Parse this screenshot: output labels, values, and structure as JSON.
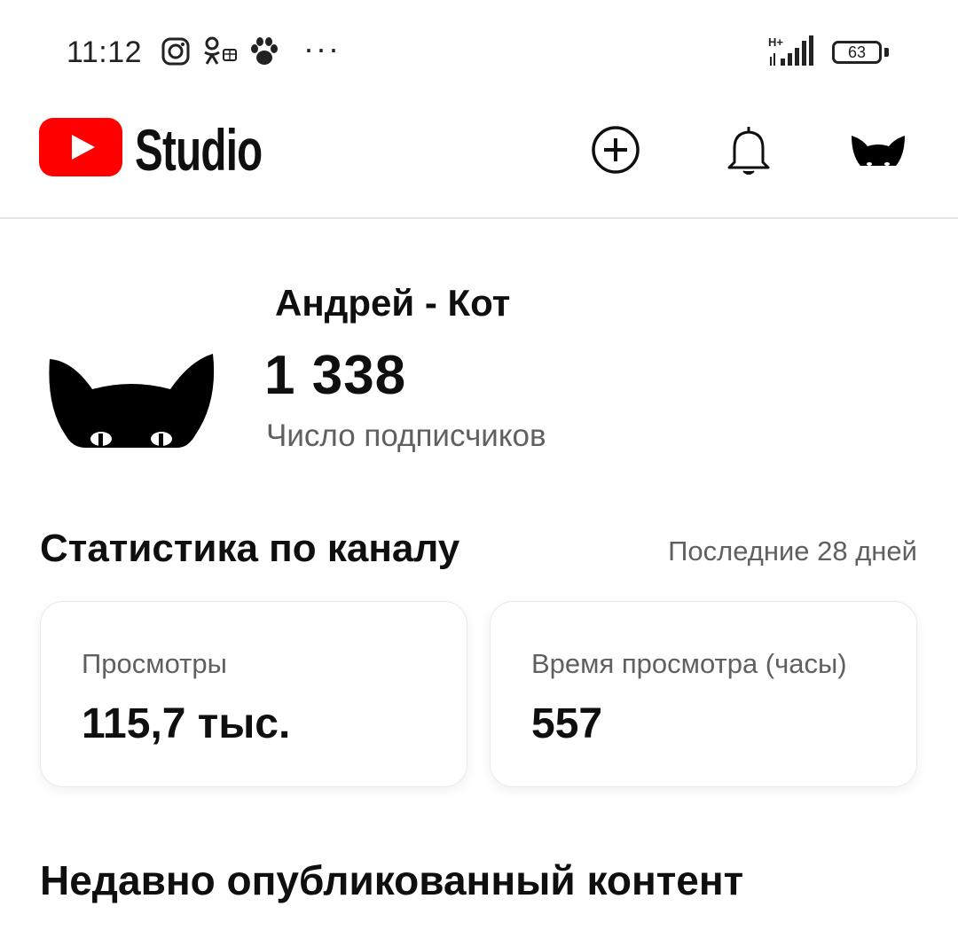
{
  "status_bar": {
    "time": "11:12",
    "network_label": "H+",
    "battery": "63"
  },
  "header": {
    "logo_text": "Studio",
    "brand_color": "#ff0000",
    "actions": [
      "create-icon",
      "bell-icon",
      "avatar"
    ]
  },
  "channel": {
    "name": "Андрей - Кот",
    "subscribers": "1 338",
    "subscribers_label": "Число подписчиков"
  },
  "stats": {
    "title": "Статистика по каналу",
    "period": "Последние 28 дней",
    "cards": [
      {
        "label": "Просмотры",
        "value": "115,7 тыс."
      },
      {
        "label": "Время просмотра (часы)",
        "value": "557"
      }
    ]
  },
  "recent": {
    "title": "Недавно опубликованный контент"
  }
}
